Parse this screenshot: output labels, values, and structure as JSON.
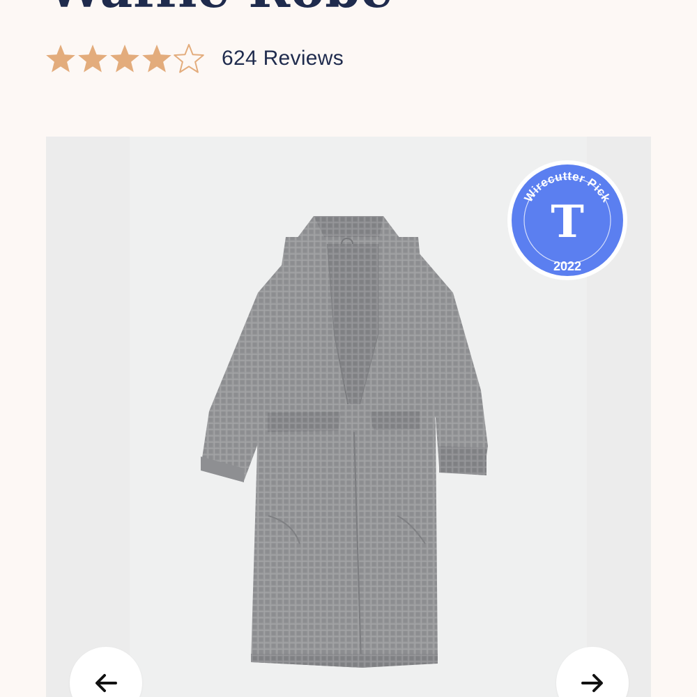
{
  "product": {
    "title": "Waffle Robe",
    "rating": {
      "value": 4,
      "max": 5,
      "review_count_label": "624 Reviews",
      "filled_color": "#e3ac7c",
      "empty_color": "#e3ac7c"
    }
  },
  "gallery": {
    "badge": {
      "top_text": "Wirecutter Pick",
      "year": "2022",
      "color": "#5b7ff0",
      "icon": "nyt-t-logo"
    },
    "prev_icon": "arrow-left-icon",
    "next_icon": "arrow-right-icon"
  }
}
